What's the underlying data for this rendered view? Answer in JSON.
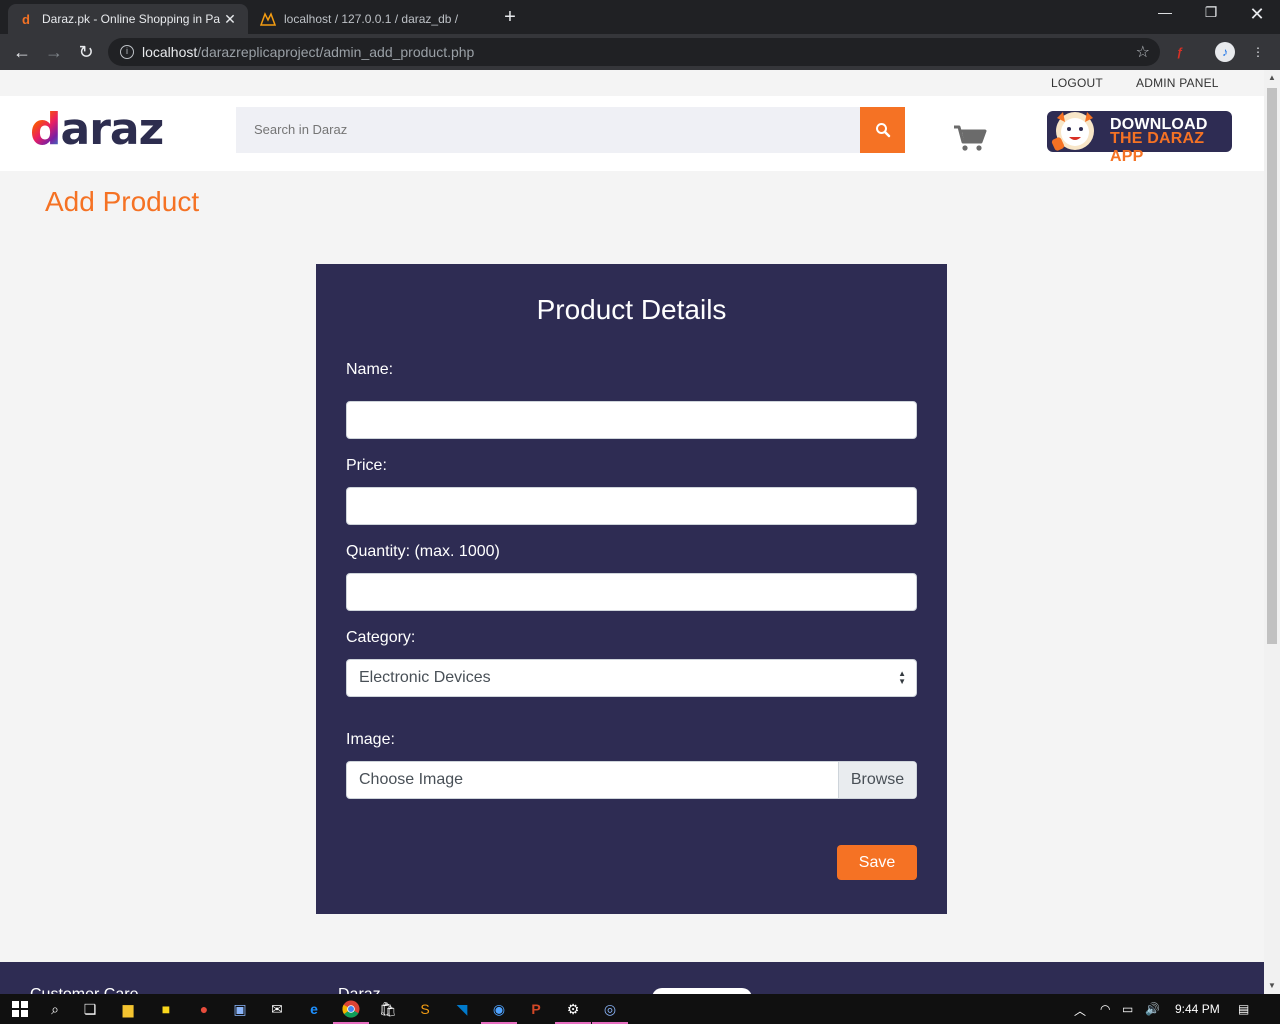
{
  "browser": {
    "tabs": [
      {
        "title": "Daraz.pk - Online Shopping in Pa",
        "favicon": "daraz-d-icon",
        "active": true
      },
      {
        "title": "localhost / 127.0.0.1 / daraz_db /",
        "favicon": "phpmyadmin-icon",
        "active": false
      }
    ],
    "url_host": "localhost",
    "url_path": "/darazreplicaproject/admin_add_product.php"
  },
  "topbar": {
    "logout": "LOGOUT",
    "admin_panel": "ADMIN PANEL"
  },
  "header": {
    "logo": {
      "d": "d",
      "rest": "araz"
    },
    "search_placeholder": "Search in Daraz",
    "app_banner": {
      "line1": "DOWNLOAD",
      "line2": "THE DARAZ APP"
    }
  },
  "page": {
    "title": "Add Product",
    "form": {
      "heading": "Product Details",
      "name_label": "Name:",
      "price_label": "Price:",
      "quantity_label": "Quantity: (max. 1000)",
      "category_label": "Category:",
      "category_value": "Electronic Devices",
      "image_label": "Image:",
      "image_placeholder": "Choose Image",
      "browse_label": "Browse",
      "save_label": "Save"
    }
  },
  "footer": {
    "col1": "Customer Care",
    "col2": "Daraz"
  },
  "taskbar": {
    "time": "9:44 PM"
  },
  "colors": {
    "accent": "#f57224",
    "navy": "#2e2c53",
    "page_bg": "#f4f4f4"
  }
}
